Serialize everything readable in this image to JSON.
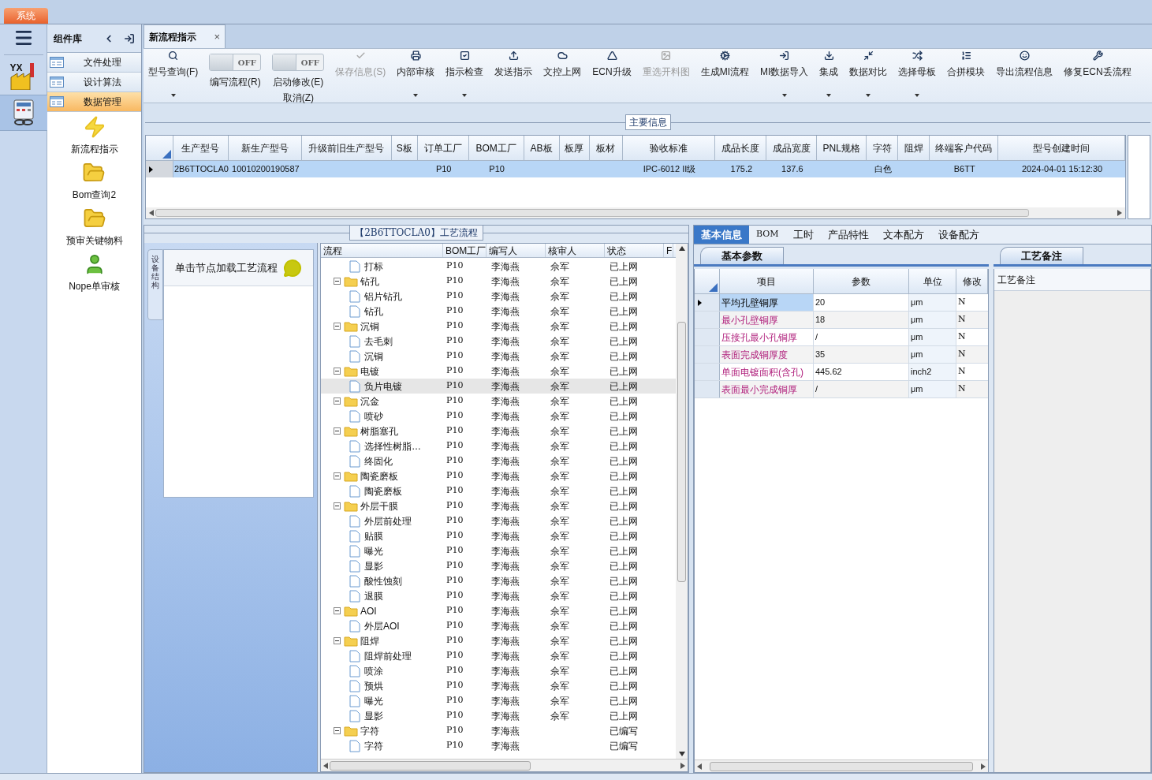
{
  "system_tab": {
    "label": "系统"
  },
  "app_logo": {
    "text": "YX"
  },
  "sidebar": {
    "title": "组件库",
    "items": [
      {
        "label": "文件处理",
        "selected": false
      },
      {
        "label": "设计算法",
        "selected": false
      },
      {
        "label": "数据管理",
        "selected": true
      }
    ],
    "modules": [
      {
        "label": "新流程指示"
      },
      {
        "label": "Bom查询2"
      },
      {
        "label": "预审关键物料"
      },
      {
        "label": "Nope单审核"
      }
    ]
  },
  "document_tab": {
    "label": "新流程指示",
    "close": "×"
  },
  "toolbar": [
    {
      "kind": "button",
      "label": "型号查询(F)",
      "dropdown": true,
      "disabled": false
    },
    {
      "kind": "toggle",
      "label": "编写流程(R)",
      "switch_text": "OFF",
      "on": false
    },
    {
      "kind": "toggle",
      "label": "启动修改(E)",
      "label2": "取消(Z)",
      "switch_text": "OFF",
      "on": false
    },
    {
      "kind": "button",
      "label": "保存信息(S)",
      "dropdown": false,
      "disabled": true
    },
    {
      "kind": "button",
      "label": "内部审核",
      "dropdown": true,
      "disabled": false
    },
    {
      "kind": "button",
      "label": "指示检查",
      "dropdown": true,
      "disabled": false
    },
    {
      "kind": "button",
      "label": "发送指示",
      "dropdown": false,
      "disabled": false
    },
    {
      "kind": "button",
      "label": "文控上网",
      "dropdown": false,
      "disabled": false
    },
    {
      "kind": "button",
      "label": "ECN升级",
      "dropdown": false,
      "disabled": false
    },
    {
      "kind": "button",
      "label": "重选开料图",
      "dropdown": false,
      "disabled": true
    },
    {
      "kind": "button",
      "label": "生成MI流程",
      "dropdown": false,
      "disabled": false
    },
    {
      "kind": "button",
      "label": "MI数据导入",
      "dropdown": true,
      "disabled": false
    },
    {
      "kind": "button",
      "label": "集成",
      "dropdown": true,
      "disabled": false
    },
    {
      "kind": "button",
      "label": "数据对比",
      "dropdown": true,
      "disabled": false
    },
    {
      "kind": "button",
      "label": "选择母板",
      "dropdown": true,
      "disabled": false
    },
    {
      "kind": "button",
      "label": "合拼模块",
      "dropdown": false,
      "disabled": false
    },
    {
      "kind": "button",
      "label": "导出流程信息",
      "dropdown": false,
      "disabled": false
    },
    {
      "kind": "button",
      "label": "修复ECN丢流程",
      "dropdown": false,
      "disabled": false
    }
  ],
  "main_info": {
    "title": "主要信息",
    "columns": [
      "生产型号",
      "新生产型号",
      "升级前旧生产型号",
      "S板",
      "订单工厂",
      "BOM工厂",
      "AB板",
      "板厚",
      "板材",
      "验收标准",
      "成品长度",
      "成品宽度",
      "PNL规格",
      "字符",
      "阻焊",
      "终端客户代码",
      "型号创建时间"
    ],
    "rows": [
      {
        "selected": true,
        "cells": [
          "2B6TTOCLA0",
          "10010200190587",
          null,
          null,
          "P10",
          "P10",
          null,
          null,
          null,
          "IPC-6012 II级",
          "175.2",
          "137.6",
          null,
          "白色",
          null,
          "B6TT",
          "2024-04-01 15:12:30"
        ]
      }
    ]
  },
  "process_panel": {
    "title": "【2B6TTOCLA0】工艺流程",
    "side_tab": "设备结构",
    "hint": "单击节点加载工艺流程",
    "columns": [
      "流程",
      "BOM工厂",
      "编写人",
      "核审人",
      "状态",
      "F"
    ],
    "tree": [
      {
        "children": [
          {
            "label": "打标",
            "bom": "P10",
            "writer": "李海燕",
            "reviewer": "佘军",
            "status": "已上网",
            "selected": false
          }
        ]
      },
      {
        "label": "钻孔",
        "bom": "P10",
        "writer": "李海燕",
        "reviewer": "佘军",
        "status": "已上网",
        "selected": false,
        "expanded": true,
        "children": [
          {
            "label": "铝片钻孔",
            "bom": "P10",
            "writer": "李海燕",
            "reviewer": "佘军",
            "status": "已上网",
            "selected": false
          },
          {
            "label": "钻孔",
            "bom": "P10",
            "writer": "李海燕",
            "reviewer": "佘军",
            "status": "已上网",
            "selected": false
          }
        ]
      },
      {
        "label": "沉铜",
        "bom": "P10",
        "writer": "李海燕",
        "reviewer": "佘军",
        "status": "已上网",
        "selected": false,
        "expanded": true,
        "children": [
          {
            "label": "去毛刺",
            "bom": "P10",
            "writer": "李海燕",
            "reviewer": "佘军",
            "status": "已上网",
            "selected": false
          },
          {
            "label": "沉铜",
            "bom": "P10",
            "writer": "李海燕",
            "reviewer": "佘军",
            "status": "已上网",
            "selected": false
          }
        ]
      },
      {
        "label": "电镀",
        "bom": "P10",
        "writer": "李海燕",
        "reviewer": "佘军",
        "status": "已上网",
        "selected": false,
        "expanded": true,
        "children": [
          {
            "label": "负片电镀",
            "bom": "P10",
            "writer": "李海燕",
            "reviewer": "佘军",
            "status": "已上网",
            "selected": true
          }
        ]
      },
      {
        "label": "沉金",
        "bom": "P10",
        "writer": "李海燕",
        "reviewer": "佘军",
        "status": "已上网",
        "selected": false,
        "expanded": true,
        "children": [
          {
            "label": "喷砂",
            "bom": "P10",
            "writer": "李海燕",
            "reviewer": "佘军",
            "status": "已上网",
            "selected": false
          }
        ]
      },
      {
        "label": "树脂塞孔",
        "bom": "P10",
        "writer": "李海燕",
        "reviewer": "佘军",
        "status": "已上网",
        "selected": false,
        "expanded": true,
        "children": [
          {
            "label": "选择性树脂…",
            "bom": "P10",
            "writer": "李海燕",
            "reviewer": "佘军",
            "status": "已上网",
            "selected": false
          },
          {
            "label": "终固化",
            "bom": "P10",
            "writer": "李海燕",
            "reviewer": "佘军",
            "status": "已上网",
            "selected": false
          }
        ]
      },
      {
        "label": "陶瓷磨板",
        "bom": "P10",
        "writer": "李海燕",
        "reviewer": "佘军",
        "status": "已上网",
        "selected": false,
        "expanded": true,
        "children": [
          {
            "label": "陶瓷磨板",
            "bom": "P10",
            "writer": "李海燕",
            "reviewer": "佘军",
            "status": "已上网",
            "selected": false
          }
        ]
      },
      {
        "label": "外层干膜",
        "bom": "P10",
        "writer": "李海燕",
        "reviewer": "佘军",
        "status": "已上网",
        "selected": false,
        "expanded": true,
        "children": [
          {
            "label": "外层前处理",
            "bom": "P10",
            "writer": "李海燕",
            "reviewer": "佘军",
            "status": "已上网",
            "selected": false
          },
          {
            "label": "贴膜",
            "bom": "P10",
            "writer": "李海燕",
            "reviewer": "佘军",
            "status": "已上网",
            "selected": false
          },
          {
            "label": "曝光",
            "bom": "P10",
            "writer": "李海燕",
            "reviewer": "佘军",
            "status": "已上网",
            "selected": false
          },
          {
            "label": "显影",
            "bom": "P10",
            "writer": "李海燕",
            "reviewer": "佘军",
            "status": "已上网",
            "selected": false
          },
          {
            "label": "酸性蚀刻",
            "bom": "P10",
            "writer": "李海燕",
            "reviewer": "佘军",
            "status": "已上网",
            "selected": false
          },
          {
            "label": "退膜",
            "bom": "P10",
            "writer": "李海燕",
            "reviewer": "佘军",
            "status": "已上网",
            "selected": false
          }
        ]
      },
      {
        "label": "AOI",
        "bom": "P10",
        "writer": "李海燕",
        "reviewer": "佘军",
        "status": "已上网",
        "selected": false,
        "expanded": true,
        "children": [
          {
            "label": "外层AOI",
            "bom": "P10",
            "writer": "李海燕",
            "reviewer": "佘军",
            "status": "已上网",
            "selected": false
          }
        ]
      },
      {
        "label": "阻焊",
        "bom": "P10",
        "writer": "李海燕",
        "reviewer": "佘军",
        "status": "已上网",
        "selected": false,
        "expanded": true,
        "children": [
          {
            "label": "阻焊前处理",
            "bom": "P10",
            "writer": "李海燕",
            "reviewer": "佘军",
            "status": "已上网",
            "selected": false
          },
          {
            "label": "喷涂",
            "bom": "P10",
            "writer": "李海燕",
            "reviewer": "佘军",
            "status": "已上网",
            "selected": false
          },
          {
            "label": "预烘",
            "bom": "P10",
            "writer": "李海燕",
            "reviewer": "佘军",
            "status": "已上网",
            "selected": false
          },
          {
            "label": "曝光",
            "bom": "P10",
            "writer": "李海燕",
            "reviewer": "佘军",
            "status": "已上网",
            "selected": false
          },
          {
            "label": "显影",
            "bom": "P10",
            "writer": "李海燕",
            "reviewer": "佘军",
            "status": "已上网",
            "selected": false
          }
        ]
      },
      {
        "label": "字符",
        "bom": "P10",
        "writer": "李海燕",
        "status": "已编写",
        "selected": false,
        "expanded": true,
        "children": [
          {
            "label": "字符",
            "bom": "P10",
            "writer": "李海燕",
            "status": "已编写",
            "selected": false
          }
        ]
      }
    ]
  },
  "detail_tabs": [
    {
      "label": "基本信息",
      "selected": true
    },
    {
      "label": "BOM",
      "selected": false
    },
    {
      "label": "工时",
      "selected": false
    },
    {
      "label": "产品特性",
      "selected": false
    },
    {
      "label": "文本配方",
      "selected": false
    },
    {
      "label": "设备配方",
      "selected": false
    }
  ],
  "basic_params": {
    "tab": "基本参数",
    "columns": [
      "项目",
      "参数",
      "单位",
      "修改"
    ],
    "rows": [
      {
        "item": "平均孔壁铜厚",
        "value": "20",
        "unit": "μm",
        "modified": "N",
        "selected": true,
        "marked": false
      },
      {
        "item": "最小孔壁铜厚",
        "value": "18",
        "unit": "μm",
        "modified": "N",
        "selected": false,
        "marked": true
      },
      {
        "item": "压接孔最小孔铜厚",
        "value": "/",
        "unit": "μm",
        "modified": "N",
        "selected": false,
        "marked": true
      },
      {
        "item": "表面完成铜厚度",
        "value": "35",
        "unit": "μm",
        "modified": "N",
        "selected": false,
        "marked": true
      },
      {
        "item": "单面电镀面积(含孔)",
        "value": "445.62",
        "unit": "inch2",
        "modified": "N",
        "selected": false,
        "marked": true
      },
      {
        "item": "表面最小完成铜厚",
        "value": "/",
        "unit": "μm",
        "modified": "N",
        "selected": false,
        "marked": true
      }
    ]
  },
  "remarks": {
    "tab": "工艺备注",
    "heading": "工艺备注"
  }
}
